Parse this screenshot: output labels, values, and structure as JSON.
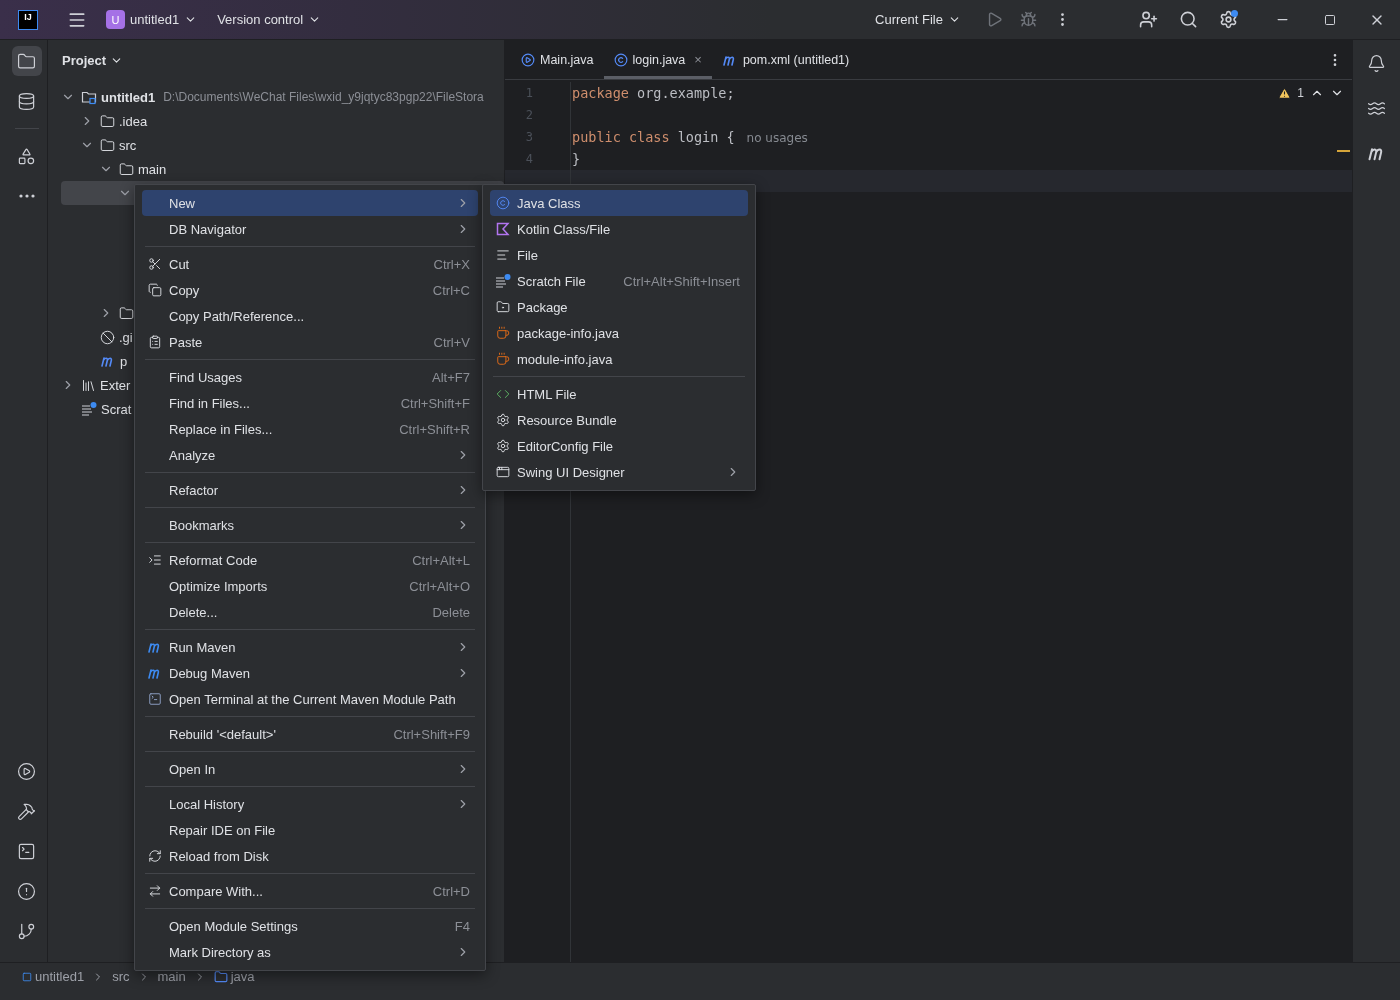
{
  "title_bar": {
    "logo": "IJ",
    "project": {
      "badge": "U",
      "name": "untitled1"
    },
    "vcs": "Version control",
    "run_config": "Current File"
  },
  "left_stripe": {
    "top": [
      {
        "kind": "project",
        "selected": true
      },
      {
        "kind": "database",
        "selected": false
      },
      {
        "kind": "structure",
        "selected": false
      },
      {
        "kind": "more",
        "selected": false
      }
    ],
    "bottom": [
      {
        "kind": "services",
        "selected": false
      },
      {
        "kind": "build",
        "selected": false
      },
      {
        "kind": "terminal",
        "selected": false
      },
      {
        "kind": "problems",
        "selected": false
      },
      {
        "kind": "git",
        "selected": false
      }
    ]
  },
  "project_panel": {
    "title": "Project",
    "tree": [
      {
        "label": "untitled1",
        "path": "D:\\Documents\\WeChat Files\\wxid_y9jqtyc83pgp22\\FileStora",
        "kind": "module",
        "expanded": true,
        "selected": false,
        "children": [
          {
            "label": ".idea",
            "kind": "folder",
            "expanded": false,
            "selected": false
          },
          {
            "label": "src",
            "kind": "folder",
            "expanded": true,
            "selected": false,
            "children": [
              {
                "label": "main",
                "kind": "folder",
                "expanded": true,
                "selected": false,
                "children": [
                  {
                    "expanded": true,
                    "selected": true
                  }
                ]
              },
              {
                "kind": "folder",
                "expanded": false,
                "selected": false
              }
            ]
          },
          {
            "label": ".gi",
            "kind": "gitignore",
            "selected": false
          },
          {
            "label": "p",
            "kind": "maven",
            "selected": false
          }
        ]
      },
      {
        "label": "Exter",
        "kind": "library",
        "expanded": false,
        "selected": false
      },
      {
        "label": "Scrat",
        "kind": "scratch",
        "selected": false
      }
    ]
  },
  "editor": {
    "tabs": [
      {
        "label": "Main.java",
        "kind": "main",
        "selected": false
      },
      {
        "label": "login.java",
        "kind": "class",
        "selected": true,
        "close": "×"
      },
      {
        "label": "pom.xml (untitled1)",
        "kind": "maven",
        "selected": false
      }
    ],
    "warnings": "1",
    "lines": [
      {
        "number": "1",
        "current": false,
        "tokens": [
          {
            "kind": "keyword",
            "text": "package"
          },
          {
            "kind": "plain",
            "text": " org.example;"
          }
        ]
      },
      {
        "number": "2",
        "current": false
      },
      {
        "number": "3",
        "current": false,
        "tokens": [
          {
            "kind": "keyword",
            "text": "public class"
          },
          {
            "kind": "plain",
            "text": " login {"
          },
          {
            "kind": "hint",
            "text": "no usages"
          }
        ]
      },
      {
        "number": "4",
        "current": false,
        "tokens": [
          {
            "kind": "plain",
            "text": "}"
          }
        ]
      },
      {
        "current": true
      }
    ]
  },
  "right_stripe": [
    {
      "kind": "notifications"
    },
    {
      "kind": "assistant"
    },
    {
      "kind": "maven"
    }
  ],
  "context_menu": [
    {
      "kind": "plain",
      "label": "New",
      "submenu": true,
      "selected": true
    },
    {
      "kind": "plain",
      "label": "DB Navigator",
      "submenu": true,
      "selected": false
    },
    {
      "kind": "separator"
    },
    {
      "kind": "cut",
      "label": "Cut",
      "shortcut": "Ctrl+X",
      "selected": false
    },
    {
      "kind": "copy",
      "label": "Copy",
      "shortcut": "Ctrl+C",
      "selected": false
    },
    {
      "kind": "plain",
      "label": "Copy Path/Reference...",
      "selected": false
    },
    {
      "kind": "paste",
      "label": "Paste",
      "shortcut": "Ctrl+V",
      "selected": false
    },
    {
      "kind": "separator"
    },
    {
      "kind": "plain",
      "label": "Find Usages",
      "shortcut": "Alt+F7",
      "selected": false
    },
    {
      "kind": "plain",
      "label": "Find in Files...",
      "shortcut": "Ctrl+Shift+F",
      "selected": false
    },
    {
      "kind": "plain",
      "label": "Replace in Files...",
      "shortcut": "Ctrl+Shift+R",
      "selected": false
    },
    {
      "kind": "plain",
      "label": "Analyze",
      "submenu": true,
      "selected": false
    },
    {
      "kind": "separator"
    },
    {
      "kind": "plain",
      "label": "Refactor",
      "submenu": true,
      "selected": false
    },
    {
      "kind": "separator"
    },
    {
      "kind": "plain",
      "label": "Bookmarks",
      "submenu": true,
      "selected": false
    },
    {
      "kind": "separator"
    },
    {
      "kind": "reformat",
      "label": "Reformat Code",
      "shortcut": "Ctrl+Alt+L",
      "selected": false
    },
    {
      "kind": "plain",
      "label": "Optimize Imports",
      "shortcut": "Ctrl+Alt+O",
      "selected": false
    },
    {
      "kind": "plain",
      "label": "Delete...",
      "shortcut": "Delete",
      "selected": false
    },
    {
      "kind": "separator"
    },
    {
      "kind": "run-maven",
      "label": "Run Maven",
      "submenu": true,
      "selected": false
    },
    {
      "kind": "debug-maven",
      "label": "Debug Maven",
      "submenu": true,
      "selected": false
    },
    {
      "kind": "terminal-maven",
      "label": "Open Terminal at the Current Maven Module Path",
      "selected": false
    },
    {
      "kind": "separator"
    },
    {
      "kind": "plain",
      "label": "Rebuild '<default>'",
      "shortcut": "Ctrl+Shift+F9",
      "selected": false
    },
    {
      "kind": "separator"
    },
    {
      "kind": "plain",
      "label": "Open In",
      "submenu": true,
      "selected": false
    },
    {
      "kind": "separator"
    },
    {
      "kind": "plain",
      "label": "Local History",
      "submenu": true,
      "selected": false
    },
    {
      "kind": "plain",
      "label": "Repair IDE on File",
      "selected": false
    },
    {
      "kind": "reload",
      "label": "Reload from Disk",
      "selected": false
    },
    {
      "kind": "separator"
    },
    {
      "kind": "compare",
      "label": "Compare With...",
      "shortcut": "Ctrl+D",
      "selected": false
    },
    {
      "kind": "separator"
    },
    {
      "kind": "plain",
      "label": "Open Module Settings",
      "shortcut": "F4",
      "selected": false
    },
    {
      "kind": "plain",
      "label": "Mark Directory as",
      "submenu": true,
      "selected": false
    }
  ],
  "new_submenu": [
    {
      "kind": "java-class",
      "label": "Java Class",
      "selected": true
    },
    {
      "kind": "kotlin",
      "label": "Kotlin Class/File",
      "selected": false
    },
    {
      "kind": "file",
      "label": "File",
      "selected": false
    },
    {
      "kind": "scratch",
      "label": "Scratch File",
      "shortcut": "Ctrl+Alt+Shift+Insert",
      "selected": false
    },
    {
      "kind": "package",
      "label": "Package",
      "selected": false
    },
    {
      "kind": "java-file",
      "label": "package-info.java",
      "selected": false
    },
    {
      "kind": "java-file",
      "label": "module-info.java",
      "selected": false
    },
    {
      "kind": "separator"
    },
    {
      "kind": "html",
      "label": "HTML File",
      "selected": false
    },
    {
      "kind": "gear",
      "label": "Resource Bundle",
      "selected": false
    },
    {
      "kind": "gear",
      "label": "EditorConfig File",
      "selected": false
    },
    {
      "kind": "window",
      "label": "Swing UI Designer",
      "submenu": true,
      "selected": false
    }
  ],
  "status_bar": {
    "breadcrumbs": [
      {
        "label": "untitled1",
        "kind": "module"
      },
      {
        "label": "src",
        "kind": "plain"
      },
      {
        "label": "main",
        "kind": "plain"
      },
      {
        "label": "java",
        "kind": "folder"
      }
    ]
  }
}
